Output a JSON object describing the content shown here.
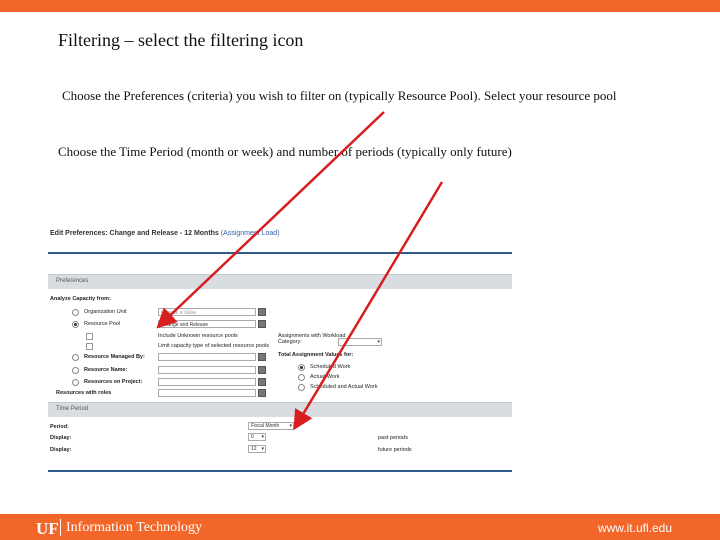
{
  "slide": {
    "title": "Filtering – select the filtering icon",
    "line1": "Choose the Preferences (criteria) you wish to filter on (typically Resource Pool).  Select your resource pool",
    "line2": "Choose the Time Period (month or week) and number of periods (typically only future)"
  },
  "screenshot": {
    "header": "Edit Preferences: Change and Release - 12 Months",
    "header_sub": "(Assignment Load)",
    "preferences_section": "Preferences",
    "analyze_label": "Analyze Capacity from:",
    "rows": {
      "org_unit": "Organization Unit",
      "resource_pool": "Resource Pool",
      "include_unknown": "Include Unknown resource pools",
      "limit_capacity": "Limit capacity type of selected resource pools",
      "resource_managed_by": "Resource Managed By:",
      "resource_name": "Resource Name:",
      "resources_on_project": "Resources on Project:",
      "resources_with_roles": "Resources with roles"
    },
    "inputs": {
      "org_placeholder": "Choose a Value",
      "pool_value": "Change and Release"
    },
    "assign_label": "Assignments with Workload Category:",
    "total_label": "Total Assignment Values for:",
    "total_options": [
      "Scheduled Work",
      "Actual Work",
      "Scheduled and Actual Work"
    ],
    "time_section": "Time Period",
    "period_label": "Period:",
    "period_value": "Fiscal Month",
    "display_label": "Display:",
    "display_past_value": "0",
    "display_past_suffix": "past periods",
    "display2_label": "Display:",
    "display_future_value": "12",
    "display_future_suffix": "future periods"
  },
  "footer": {
    "logo": "UF",
    "org": "Information Technology",
    "url": "www.it.ufl.edu"
  },
  "colors": {
    "accent": "#f2662a",
    "arrow": "#d81e1e",
    "rule": "#2f5a8c"
  }
}
